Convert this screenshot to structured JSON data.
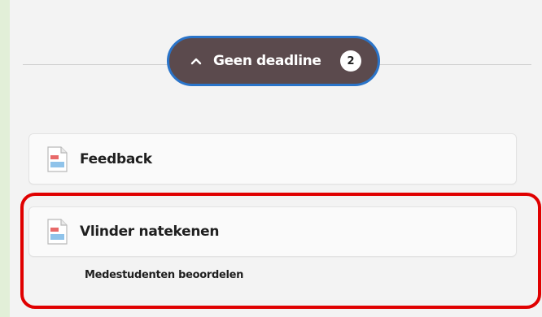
{
  "deadline_group": {
    "label": "Geen deadline",
    "count": "2",
    "icon": "chevron-up-icon",
    "colors": {
      "pill_bg": "#5b4a4d",
      "pill_border": "#2a74c9"
    }
  },
  "items": [
    {
      "title": "Feedback",
      "icon": "document-icon"
    },
    {
      "title": "Vlinder natekenen",
      "icon": "document-icon",
      "sub_label": "Medestudenten beoordelen"
    }
  ],
  "annotation": {
    "highlight_color": "#e00000"
  }
}
